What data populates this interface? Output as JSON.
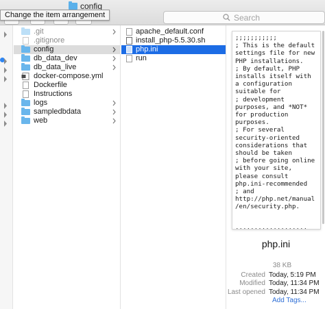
{
  "window": {
    "title": "config",
    "tooltip": "Change the item arrangement"
  },
  "search": {
    "placeholder": "Search"
  },
  "column1": {
    "items": [
      {
        "label": ".git",
        "kind": "folder",
        "muted": true,
        "chevron": true
      },
      {
        "label": ".gitignore",
        "kind": "file",
        "muted": true,
        "chevron": false
      },
      {
        "label": "config",
        "kind": "folder",
        "muted": false,
        "chevron": true,
        "state": "selected-inactive"
      },
      {
        "label": "db_data_dev",
        "kind": "folder",
        "muted": false,
        "chevron": true
      },
      {
        "label": "db_data_live",
        "kind": "folder",
        "muted": false,
        "chevron": true
      },
      {
        "label": "docker-compose.yml",
        "kind": "yml",
        "muted": false,
        "chevron": false
      },
      {
        "label": "Dockerfile",
        "kind": "file",
        "muted": false,
        "chevron": false
      },
      {
        "label": "Instructions",
        "kind": "file",
        "muted": false,
        "chevron": false
      },
      {
        "label": "logs",
        "kind": "folder",
        "muted": false,
        "chevron": true
      },
      {
        "label": "sampledbdata",
        "kind": "folder",
        "muted": false,
        "chevron": true
      },
      {
        "label": "web",
        "kind": "folder",
        "muted": false,
        "chevron": true
      }
    ]
  },
  "column2": {
    "items": [
      {
        "label": "apache_default.conf",
        "kind": "file"
      },
      {
        "label": "install_php-5.5.30.sh",
        "kind": "file-dark"
      },
      {
        "label": "php.ini",
        "kind": "file-selected",
        "state": "selected"
      },
      {
        "label": "run",
        "kind": "file"
      }
    ]
  },
  "preview": {
    "text": ";;;;;;;;;;;\n; This is the default settings file for new PHP installations.\n; By default, PHP installs itself with a configuration suitable for\n; development purposes, and *NOT* for production purposes.\n; For several security-oriented considerations that should be taken\n; before going online with your site, please consult php.ini-recommended\n; and http://php.net/manual/en/security.php.\n\n\n;;;;;;;;;;;;;;;;;;;\n; About this file ;\n;;;;;;;;;;;;;;;;;;;\n; This file controls many aspects of PHP's behavior.  In order for PHP to\n; read it, it must be named 'php.ini'.  PHP",
    "filename": "php.ini",
    "size": "38 KB",
    "meta": [
      {
        "key": "Created",
        "value": "Today, 5:19 PM"
      },
      {
        "key": "Modified",
        "value": "Today, 11:34 PM"
      },
      {
        "key": "Last opened",
        "value": "Today, 11:34 PM"
      }
    ],
    "add_tags": "Add Tags..."
  },
  "colors": {
    "selection": "#1c6ce5",
    "folder": "#69b6ec",
    "link": "#2f6fd6"
  }
}
